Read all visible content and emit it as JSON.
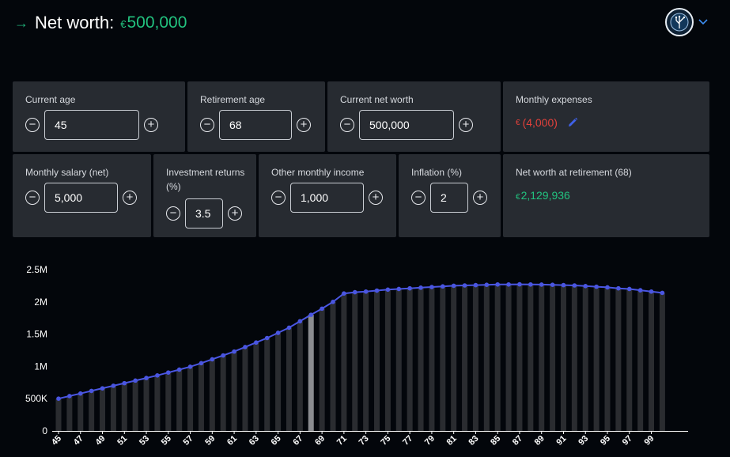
{
  "header": {
    "title": "Net worth:",
    "currency_symbol": "€",
    "amount": "500,000"
  },
  "inputs": {
    "current_age": {
      "label": "Current age",
      "value": "45"
    },
    "retirement_age": {
      "label": "Retirement age",
      "value": "68"
    },
    "current_net_worth": {
      "label": "Current net worth",
      "value": "500,000"
    },
    "monthly_expenses": {
      "label": "Monthly expenses",
      "currency": "€",
      "value": "(4,000)"
    },
    "monthly_salary": {
      "label": "Monthly salary (net)",
      "value": "5,000"
    },
    "investment_returns": {
      "label": "Investment returns (%)",
      "value": "3.5"
    },
    "other_income": {
      "label": "Other monthly income",
      "value": "1,000"
    },
    "inflation": {
      "label": "Inflation (%)",
      "value": "2"
    },
    "net_worth_retirement": {
      "label": "Net worth at retirement (68)",
      "currency": "€",
      "value": "2,129,936"
    }
  },
  "colors": {
    "accent_green": "#22c27f",
    "expense_red": "#e2413b",
    "line_blue": "#4a56e2",
    "bar": "#2a2c30",
    "retirement_bar": "#8a8c90"
  },
  "chart_data": {
    "type": "bar",
    "x": [
      45,
      46,
      47,
      48,
      49,
      50,
      51,
      52,
      53,
      54,
      55,
      56,
      57,
      58,
      59,
      60,
      61,
      62,
      63,
      64,
      65,
      66,
      67,
      68,
      69,
      70,
      71,
      72,
      73,
      74,
      75,
      76,
      77,
      78,
      79,
      80,
      81,
      82,
      83,
      84,
      85,
      86,
      87,
      88,
      89,
      90,
      91,
      92,
      93,
      94,
      95,
      96,
      97,
      98,
      99,
      100
    ],
    "x_tick_labels": [
      "45",
      "47",
      "49",
      "51",
      "53",
      "55",
      "57",
      "59",
      "61",
      "63",
      "65",
      "67",
      "69",
      "71",
      "73",
      "75",
      "77",
      "79",
      "81",
      "83",
      "85",
      "87",
      "89",
      "91",
      "93",
      "95",
      "97",
      "99"
    ],
    "series": [
      {
        "values": [
          500000,
          540000,
          580000,
          620000,
          660000,
          700000,
          740000,
          780000,
          820000,
          860000,
          905000,
          950000,
          995000,
          1050000,
          1110000,
          1170000,
          1230000,
          1300000,
          1370000,
          1440000,
          1520000,
          1600000,
          1700000,
          1800000,
          1895000,
          2000000,
          2129936,
          2150000,
          2160000,
          2175000,
          2190000,
          2200000,
          2210000,
          2220000,
          2230000,
          2240000,
          2250000,
          2255000,
          2260000,
          2265000,
          2270000,
          2270000,
          2272000,
          2270000,
          2268000,
          2265000,
          2260000,
          2255000,
          2245000,
          2235000,
          2225000,
          2210000,
          2200000,
          2180000,
          2160000,
          2140000,
          2110000,
          2085000,
          2055000
        ]
      }
    ],
    "y_ticks": [
      "0",
      "500K",
      "1M",
      "1.5M",
      "2M",
      "2.5M"
    ],
    "ylim": [
      0,
      2500000
    ],
    "highlight_x": 68,
    "grid": false,
    "xlabel": "",
    "ylabel": ""
  }
}
